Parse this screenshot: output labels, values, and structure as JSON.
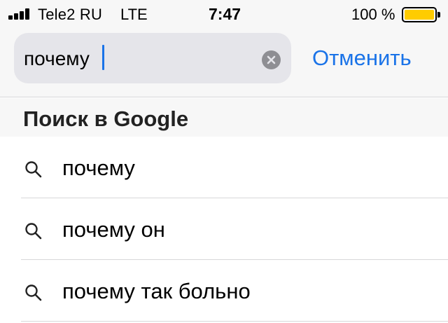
{
  "status_bar": {
    "carrier": "Tele2 RU",
    "network": "LTE",
    "time": "7:47",
    "battery_percent": "100 %",
    "battery_color": "#ffcc00"
  },
  "search": {
    "query": "почему",
    "clear_icon": "clear-x-circle-icon",
    "cancel_label": "Отменить",
    "accent_color": "#1a73e8"
  },
  "section": {
    "title": "Поиск в Google"
  },
  "suggestions": [
    {
      "icon": "search-icon",
      "text": "почему"
    },
    {
      "icon": "search-icon",
      "text": "почему он"
    },
    {
      "icon": "search-icon",
      "text": "почему так больно"
    }
  ]
}
